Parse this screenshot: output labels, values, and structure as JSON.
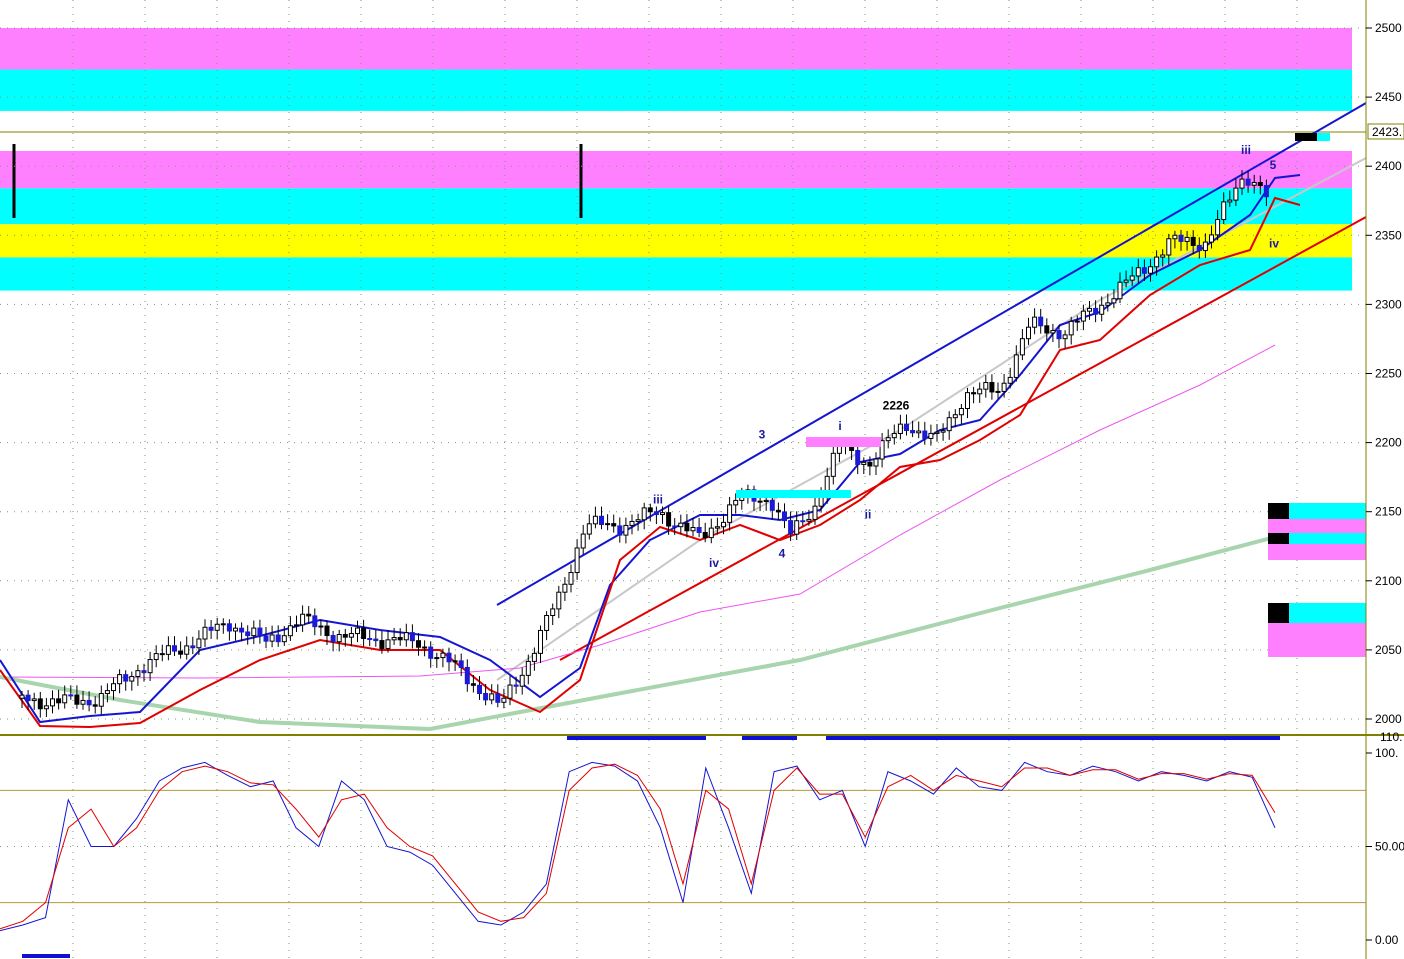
{
  "chart_data": [
    {
      "panel": "price",
      "type": "candlestick",
      "y_axis": {
        "ticks": [
          "2500",
          "2450",
          "2400",
          "2350",
          "2300",
          "2250",
          "2200",
          "2150",
          "2100",
          "2050",
          "2000"
        ],
        "current_price_label": "2423.",
        "ylim": [
          1990,
          2515
        ]
      },
      "colors": {
        "up": "#ffffff",
        "down_blue": "#1b1bd6",
        "down_black": "#000000",
        "magenta_zone": "#ff80ff",
        "cyan_zone": "#00ffff",
        "yellow_zone": "#ffff00"
      },
      "price_zones": [
        {
          "color": "magenta",
          "from": 2470,
          "to": 2500
        },
        {
          "color": "cyan",
          "from": 2440,
          "to": 2470
        },
        {
          "color": "magenta",
          "from": 2384,
          "to": 2411
        },
        {
          "color": "cyan",
          "from": 2358,
          "to": 2384
        },
        {
          "color": "yellow",
          "from": 2334,
          "to": 2358
        },
        {
          "color": "cyan",
          "from": 2310,
          "to": 2334
        }
      ],
      "wave_labels": [
        {
          "text": "iii",
          "price": 2156
        },
        {
          "text": "iv",
          "price": 2110
        },
        {
          "text": "3",
          "price": 2203
        },
        {
          "text": "4",
          "price": 2117
        },
        {
          "text": "i",
          "price": 2209
        },
        {
          "text": "ii",
          "price": 2145
        },
        {
          "text": "2226",
          "price": 2224
        },
        {
          "text": "iii",
          "price": 2409
        },
        {
          "text": "5",
          "price": 2398
        },
        {
          "text": "iv",
          "price": 2341
        }
      ],
      "lines": [
        "upper trend channel (blue)",
        "lower trend channel (red)",
        "fast moving average (blue)",
        "slow moving average (red)",
        "trend line (grey)",
        "long moving average (magenta)",
        "200-period average (green)"
      ]
    },
    {
      "panel": "stochastic",
      "type": "line",
      "y_axis": {
        "ticks": [
          "100.",
          "50.00",
          "0.00"
        ],
        "top_label": "110.",
        "ylim": [
          0,
          110
        ]
      },
      "reference_levels": [
        80,
        20
      ],
      "series": [
        {
          "values": [
            5,
            8,
            12,
            75,
            50,
            50,
            65,
            85,
            92,
            95,
            88,
            82,
            85,
            60,
            50,
            85,
            75,
            50,
            47,
            40,
            25,
            10,
            8,
            15,
            30,
            90,
            95,
            93,
            85,
            60,
            20,
            92,
            60,
            25,
            90,
            93,
            75,
            80,
            50,
            90,
            85,
            78,
            92,
            82,
            80,
            95,
            90,
            88,
            93,
            90,
            85,
            90,
            88,
            85,
            90,
            87,
            60
          ]
        },
        {
          "values": [
            6,
            10,
            20,
            60,
            70,
            50,
            60,
            80,
            90,
            93,
            90,
            84,
            83,
            70,
            55,
            75,
            78,
            60,
            50,
            45,
            30,
            15,
            10,
            12,
            25,
            80,
            92,
            94,
            88,
            70,
            30,
            80,
            70,
            30,
            80,
            92,
            78,
            78,
            55,
            82,
            88,
            80,
            88,
            85,
            82,
            92,
            92,
            88,
            91,
            91,
            86,
            89,
            89,
            86,
            89,
            88,
            68
          ]
        }
      ]
    }
  ]
}
